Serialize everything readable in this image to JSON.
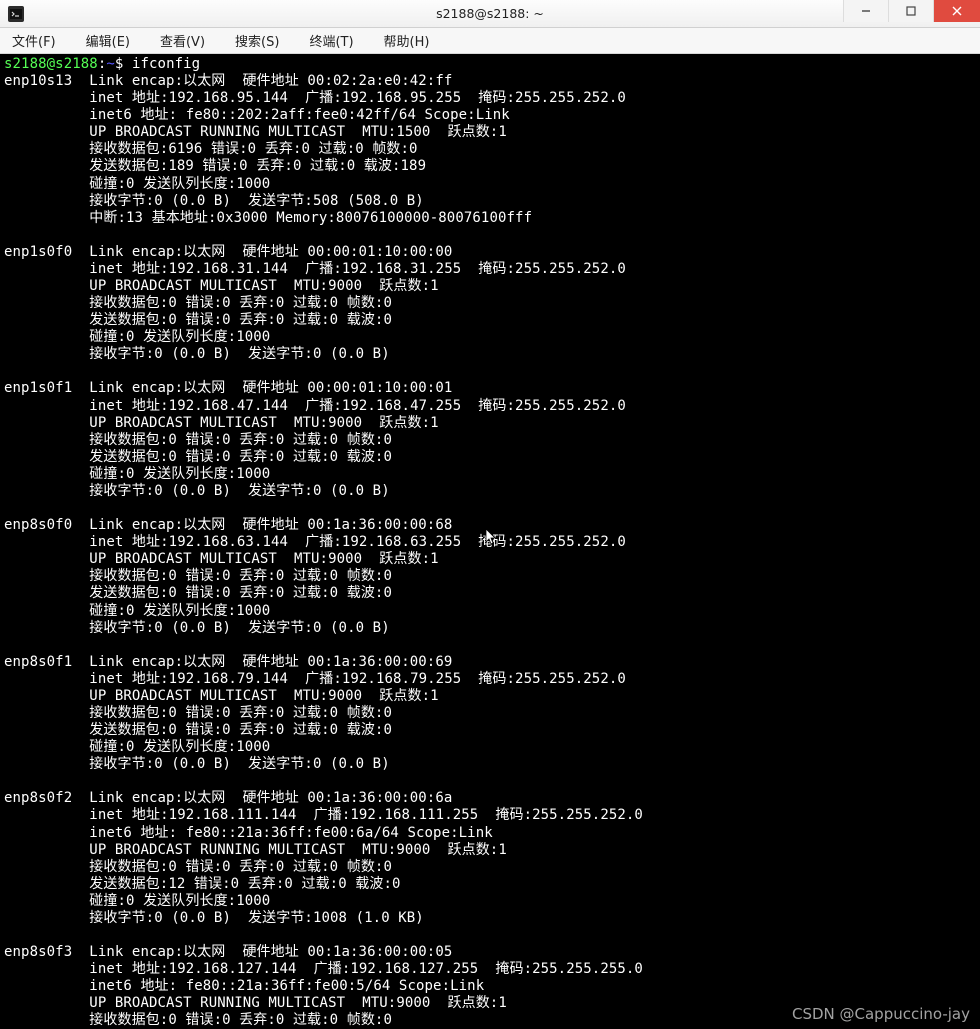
{
  "window": {
    "title": "s2188@s2188: ~"
  },
  "menu": {
    "file": "文件(F)",
    "edit": "编辑(E)",
    "view": "查看(V)",
    "search": "搜索(S)",
    "terminal": "终端(T)",
    "help": "帮助(H)"
  },
  "prompt": {
    "userhost": "s2188@s2188",
    "sep": ":",
    "path": "~",
    "dollar": "$ ",
    "command": "ifconfig"
  },
  "lines": {
    "l01": "enp10s13  Link encap:以太网  硬件地址 00:02:2a:e0:42:ff  ",
    "l02": "          inet 地址:192.168.95.144  广播:192.168.95.255  掩码:255.255.252.0",
    "l03": "          inet6 地址: fe80::202:2aff:fee0:42ff/64 Scope:Link",
    "l04": "          UP BROADCAST RUNNING MULTICAST  MTU:1500  跃点数:1",
    "l05": "          接收数据包:6196 错误:0 丢弃:0 过载:0 帧数:0",
    "l06": "          发送数据包:189 错误:0 丢弃:0 过载:0 载波:189",
    "l07": "          碰撞:0 发送队列长度:1000 ",
    "l08": "          接收字节:0 (0.0 B)  发送字节:508 (508.0 B)",
    "l09": "          中断:13 基本地址:0x3000 Memory:80076100000-80076100fff ",
    "l10": "",
    "l11": "enp1s0f0  Link encap:以太网  硬件地址 00:00:01:10:00:00  ",
    "l12": "          inet 地址:192.168.31.144  广播:192.168.31.255  掩码:255.255.252.0",
    "l13": "          UP BROADCAST MULTICAST  MTU:9000  跃点数:1",
    "l14": "          接收数据包:0 错误:0 丢弃:0 过载:0 帧数:0",
    "l15": "          发送数据包:0 错误:0 丢弃:0 过载:0 载波:0",
    "l16": "          碰撞:0 发送队列长度:1000 ",
    "l17": "          接收字节:0 (0.0 B)  发送字节:0 (0.0 B)",
    "l18": "",
    "l19": "enp1s0f1  Link encap:以太网  硬件地址 00:00:01:10:00:01  ",
    "l20": "          inet 地址:192.168.47.144  广播:192.168.47.255  掩码:255.255.252.0",
    "l21": "          UP BROADCAST MULTICAST  MTU:9000  跃点数:1",
    "l22": "          接收数据包:0 错误:0 丢弃:0 过载:0 帧数:0",
    "l23": "          发送数据包:0 错误:0 丢弃:0 过载:0 载波:0",
    "l24": "          碰撞:0 发送队列长度:1000 ",
    "l25": "          接收字节:0 (0.0 B)  发送字节:0 (0.0 B)",
    "l26": "",
    "l27": "enp8s0f0  Link encap:以太网  硬件地址 00:1a:36:00:00:68  ",
    "l28": "          inet 地址:192.168.63.144  广播:192.168.63.255  掩码:255.255.252.0",
    "l29": "          UP BROADCAST MULTICAST  MTU:9000  跃点数:1",
    "l30": "          接收数据包:0 错误:0 丢弃:0 过载:0 帧数:0",
    "l31": "          发送数据包:0 错误:0 丢弃:0 过载:0 载波:0",
    "l32": "          碰撞:0 发送队列长度:1000 ",
    "l33": "          接收字节:0 (0.0 B)  发送字节:0 (0.0 B)",
    "l34": "",
    "l35": "enp8s0f1  Link encap:以太网  硬件地址 00:1a:36:00:00:69  ",
    "l36": "          inet 地址:192.168.79.144  广播:192.168.79.255  掩码:255.255.252.0",
    "l37": "          UP BROADCAST MULTICAST  MTU:9000  跃点数:1",
    "l38": "          接收数据包:0 错误:0 丢弃:0 过载:0 帧数:0",
    "l39": "          发送数据包:0 错误:0 丢弃:0 过载:0 载波:0",
    "l40": "          碰撞:0 发送队列长度:1000 ",
    "l41": "          接收字节:0 (0.0 B)  发送字节:0 (0.0 B)",
    "l42": "",
    "l43": "enp8s0f2  Link encap:以太网  硬件地址 00:1a:36:00:00:6a  ",
    "l44": "          inet 地址:192.168.111.144  广播:192.168.111.255  掩码:255.255.252.0",
    "l45": "          inet6 地址: fe80::21a:36ff:fe00:6a/64 Scope:Link",
    "l46": "          UP BROADCAST RUNNING MULTICAST  MTU:9000  跃点数:1",
    "l47": "          接收数据包:0 错误:0 丢弃:0 过载:0 帧数:0",
    "l48": "          发送数据包:12 错误:0 丢弃:0 过载:0 载波:0",
    "l49": "          碰撞:0 发送队列长度:1000 ",
    "l50": "          接收字节:0 (0.0 B)  发送字节:1008 (1.0 KB)",
    "l51": "",
    "l52": "enp8s0f3  Link encap:以太网  硬件地址 00:1a:36:00:00:05  ",
    "l53": "          inet 地址:192.168.127.144  广播:192.168.127.255  掩码:255.255.255.0",
    "l54": "          inet6 地址: fe80::21a:36ff:fe00:5/64 Scope:Link",
    "l55": "          UP BROADCAST RUNNING MULTICAST  MTU:9000  跃点数:1",
    "l56": "          接收数据包:0 错误:0 丢弃:0 过载:0 帧数:0"
  },
  "watermark": "CSDN @Cappuccino-jay"
}
